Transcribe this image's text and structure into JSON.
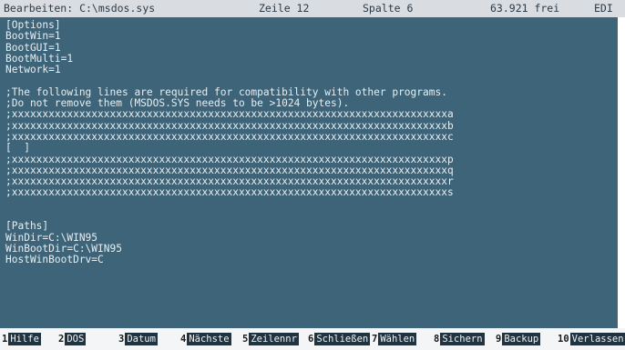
{
  "statusbar": {
    "mode": "Bearbeiten: C:\\msdos.sys",
    "line": "Zeile 12",
    "column": "Spalte 6",
    "free": "63.921 frei",
    "ins": "EDI"
  },
  "editor": {
    "lines": [
      "[Options]",
      "BootWin=1",
      "BootGUI=1",
      "BootMulti=1",
      "Network=1",
      "",
      ";The following lines are required for compatibility with other programs.",
      ";Do not remove them (MSDOS.SYS needs to be >1024 bytes).",
      ";xxxxxxxxxxxxxxxxxxxxxxxxxxxxxxxxxxxxxxxxxxxxxxxxxxxxxxxxxxxxxxxxxxxxxxxa",
      ";xxxxxxxxxxxxxxxxxxxxxxxxxxxxxxxxxxxxxxxxxxxxxxxxxxxxxxxxxxxxxxxxxxxxxxxb",
      ";xxxxxxxxxxxxxxxxxxxxxxxxxxxxxxxxxxxxxxxxxxxxxxxxxxxxxxxxxxxxxxxxxxxxxxxc",
      "[  ]",
      ";xxxxxxxxxxxxxxxxxxxxxxxxxxxxxxxxxxxxxxxxxxxxxxxxxxxxxxxxxxxxxxxxxxxxxxxp",
      ";xxxxxxxxxxxxxxxxxxxxxxxxxxxxxxxxxxxxxxxxxxxxxxxxxxxxxxxxxxxxxxxxxxxxxxxq",
      ";xxxxxxxxxxxxxxxxxxxxxxxxxxxxxxxxxxxxxxxxxxxxxxxxxxxxxxxxxxxxxxxxxxxxxxxr",
      ";xxxxxxxxxxxxxxxxxxxxxxxxxxxxxxxxxxxxxxxxxxxxxxxxxxxxxxxxxxxxxxxxxxxxxxxs",
      "",
      "",
      "[Paths]",
      "WinDir=C:\\WIN95",
      "WinBootDir=C:\\WIN95",
      "HostWinBootDrv=C"
    ]
  },
  "fkeys": [
    {
      "num": "1",
      "label": "Hilfe"
    },
    {
      "num": "2",
      "label": "DOS"
    },
    {
      "num": "3",
      "label": "Datum"
    },
    {
      "num": "4",
      "label": "Nächste"
    },
    {
      "num": "5",
      "label": "Zeilennr"
    },
    {
      "num": "6",
      "label": "Schließen"
    },
    {
      "num": "7",
      "label": "Wählen"
    },
    {
      "num": "8",
      "label": "Sichern"
    },
    {
      "num": "9",
      "label": "Backup"
    },
    {
      "num": "10",
      "label": "Verlassen"
    }
  ]
}
